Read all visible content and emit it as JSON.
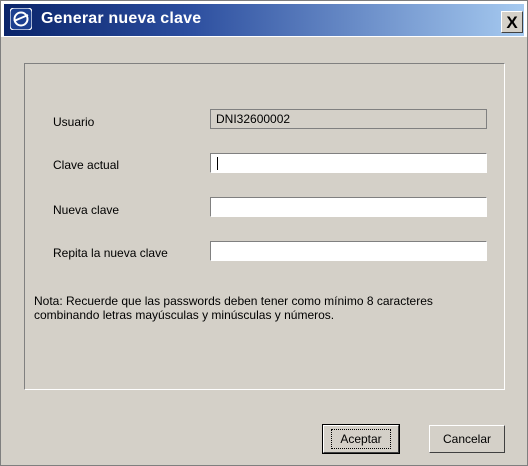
{
  "window": {
    "title": "Generar nueva clave",
    "close_symbol": "X",
    "icon": "app-logo-icon"
  },
  "form": {
    "usuario_label": "Usuario",
    "usuario_value": "DNI32600002",
    "clave_actual_label": "Clave actual",
    "clave_actual_value": "",
    "nueva_clave_label": "Nueva clave",
    "nueva_clave_value": "",
    "repita_label": "Repita la nueva clave",
    "repita_value": ""
  },
  "note": {
    "line1": "Nota: Recuerde que las passwords deben tener como mínimo 8 caracteres",
    "line2": "combinando letras mayúsculas y minúsculas y números."
  },
  "buttons": {
    "accept_label": "Aceptar",
    "cancel_label": "Cancelar"
  },
  "colors": {
    "title_start": "#0a246a",
    "title_end": "#a6caf0",
    "dialog_bg": "#d4d0c8"
  }
}
